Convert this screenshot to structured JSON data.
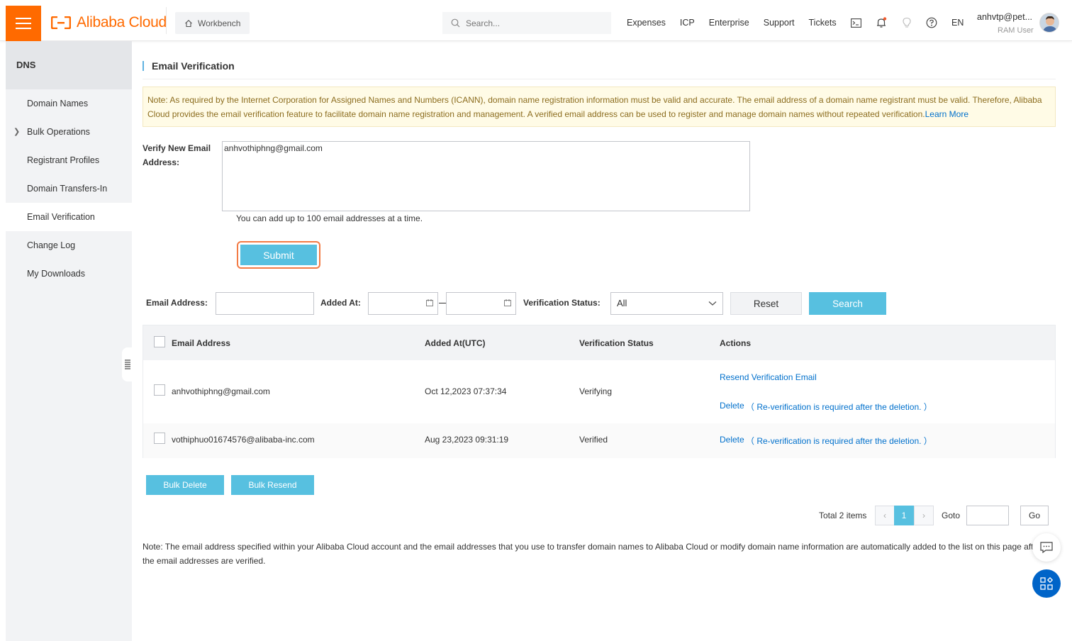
{
  "header": {
    "brand": "Alibaba Cloud",
    "workbench": "Workbench",
    "search_placeholder": "Search...",
    "links": [
      "Expenses",
      "ICP",
      "Enterprise",
      "Support",
      "Tickets"
    ],
    "lang": "EN",
    "user_name": "anhvtp@pet...",
    "user_role": "RAM User",
    "accent_color": "#ff6a00"
  },
  "sidebar": {
    "title": "DNS",
    "items": [
      {
        "label": "Domain Names"
      },
      {
        "label": "Bulk Operations"
      },
      {
        "label": "Registrant Profiles"
      },
      {
        "label": "Domain Transfers-In"
      },
      {
        "label": "Email Verification"
      },
      {
        "label": "Change Log"
      },
      {
        "label": "My Downloads"
      }
    ]
  },
  "page": {
    "title": "Email Verification",
    "notice": "Note: As required by the Internet Corporation for Assigned Names and Numbers (ICANN), domain name registration information must be valid and accurate. The email address of a domain name registrant must be valid. Therefore, Alibaba Cloud provides the email verification feature to facilitate domain name registration and management. A verified email address can be used to register and manage domain names without repeated verification.",
    "notice_link": "Learn More",
    "verify_label": "Verify New Email Address:",
    "verify_value": "anhvothiphng@gmail.com",
    "hint": "You can add up to 100 email addresses at a time.",
    "submit_label": "Submit"
  },
  "filters": {
    "email_label": "Email Address:",
    "added_label": "Added At:",
    "status_label": "Verification Status:",
    "status_value": "All",
    "reset_label": "Reset",
    "search_label": "Search"
  },
  "table": {
    "headers": [
      "Email Address",
      "Added At(UTC)",
      "Verification Status",
      "Actions"
    ],
    "rows": [
      {
        "email": "anhvothiphng@gmail.com",
        "added": "Oct 12,2023 07:37:34",
        "status": "Verifying",
        "resend": "Resend Verification Email",
        "delete": "Delete",
        "delete_note": "（ Re-verification is required after the deletion. ）"
      },
      {
        "email": "vothiphuo01674576@alibaba-inc.com",
        "added": "Aug 23,2023 09:31:19",
        "status": "Verified",
        "delete": "Delete",
        "delete_note": "（ Re-verification is required after the deletion. ）"
      }
    ]
  },
  "bulk": {
    "delete_label": "Bulk Delete",
    "resend_label": "Bulk Resend"
  },
  "pager": {
    "total": "Total 2 items",
    "current": "1",
    "goto_label": "Goto",
    "go_label": "Go"
  },
  "footnote": "Note: The email address specified within your Alibaba Cloud account and the email addresses that you use to transfer domain names to Alibaba Cloud or modify domain name information are automatically added to the list on this page after the email addresses are verified."
}
